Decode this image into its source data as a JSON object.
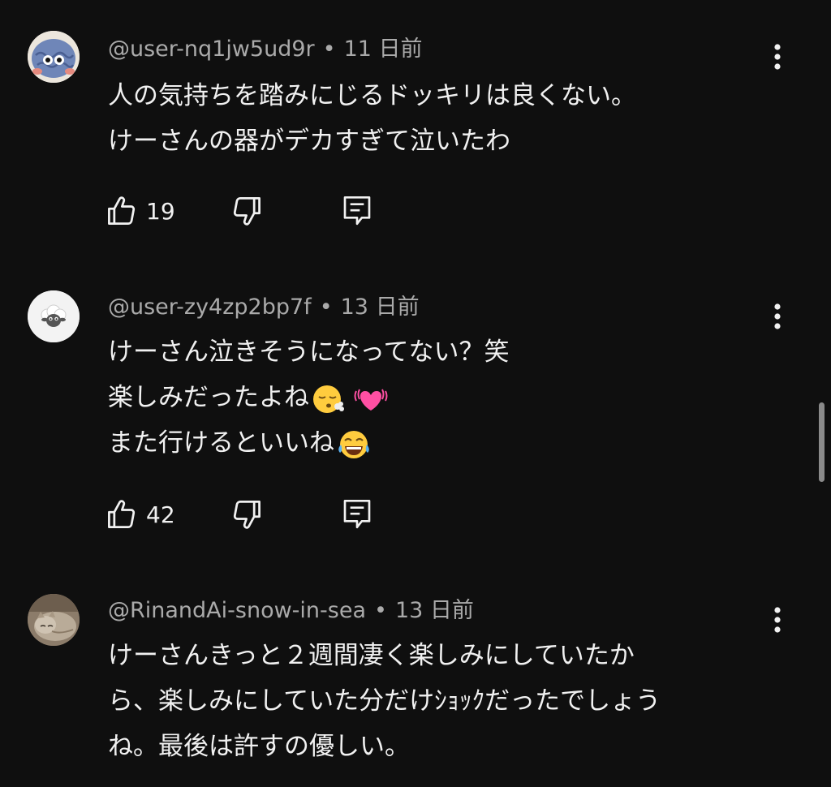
{
  "comments": [
    {
      "author": "@user-nq1jw5ud9r",
      "separator": "•",
      "time": "11 日前",
      "lines": [
        "人の気持ちを踏みにじるドッキリは良くない。",
        "けーさんの器がデカすぎて泣いたわ"
      ],
      "likes": "19",
      "avatar_icon": "brain-character-avatar"
    },
    {
      "author": "@user-zy4zp2bp7f",
      "separator": "•",
      "time": "13 日前",
      "lines": [
        "けーさん泣きそうになってない？笑",
        "楽しみだったよね",
        "また行けるといいね"
      ],
      "likes": "42",
      "avatar_icon": "sheep-avatar"
    },
    {
      "author": "@RinandAi-snow-in-sea",
      "separator": "•",
      "time": "13 日前",
      "lines": [
        "けーさんきっと２週間凄く楽しみにしていたか",
        "ら、楽しみにしていた分だけｼｮｯｸだったでしょう",
        "ね。最後は許すの優しい。"
      ],
      "avatar_icon": "cat-photo-avatar"
    }
  ],
  "colors": {
    "background": "#0f0f0f",
    "text_primary": "#f1f1f1",
    "text_secondary": "#aaaaaa",
    "scrollbar": "#8a8a8a"
  }
}
